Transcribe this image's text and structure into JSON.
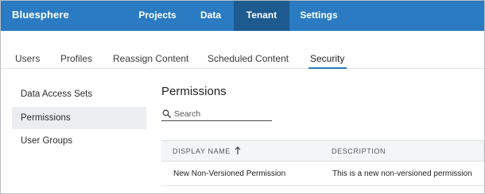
{
  "topnav": {
    "brand": "Bluesphere",
    "items": [
      {
        "label": "Projects",
        "active": false
      },
      {
        "label": "Data",
        "active": false
      },
      {
        "label": "Tenant",
        "active": true
      },
      {
        "label": "Settings",
        "active": false
      }
    ],
    "accent_color": "#2a7bc1",
    "active_color": "#1c5a8f"
  },
  "subtabs": {
    "items": [
      {
        "label": "Users",
        "active": false
      },
      {
        "label": "Profiles",
        "active": false
      },
      {
        "label": "Reassign Content",
        "active": false
      },
      {
        "label": "Scheduled Content",
        "active": false
      },
      {
        "label": "Security",
        "active": true
      }
    ]
  },
  "sidebar": {
    "items": [
      {
        "label": "Data Access Sets",
        "active": false
      },
      {
        "label": "Permissions",
        "active": true
      },
      {
        "label": "User Groups",
        "active": false
      }
    ]
  },
  "main": {
    "title": "Permissions",
    "search": {
      "placeholder": "Search",
      "value": "",
      "icon": "search-icon"
    },
    "table": {
      "columns": [
        {
          "label": "DISPLAY NAME",
          "sorted": "ascending",
          "sort_icon": "arrow-up-icon"
        },
        {
          "label": "DESCRIPTION"
        }
      ],
      "rows": [
        {
          "display_name": "New Non-Versioned Permission",
          "description": "This is a new non-versioned permission"
        }
      ]
    }
  }
}
